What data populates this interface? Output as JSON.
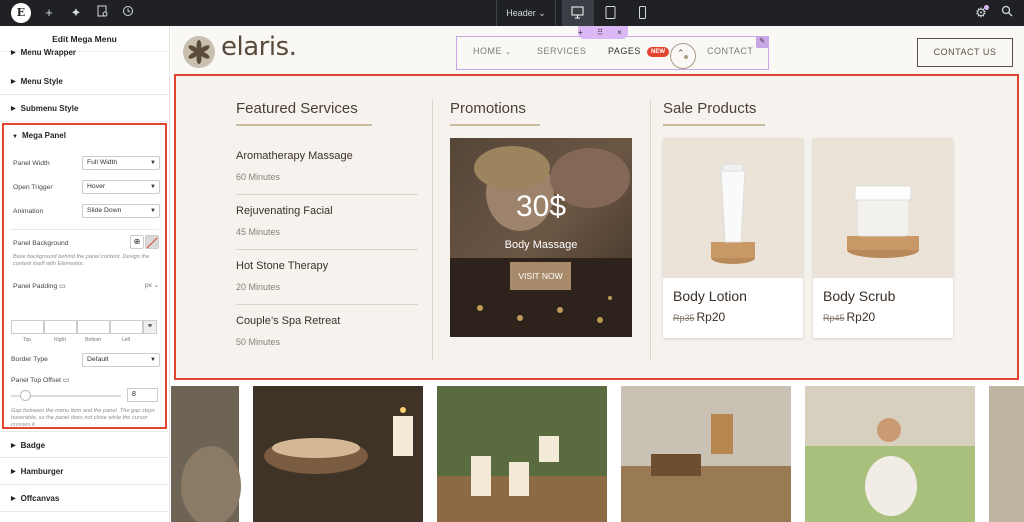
{
  "topbar": {
    "document": "Header",
    "icons": [
      "elementor-logo-icon",
      "plus-icon",
      "sparkle-icon",
      "page-settings-icon",
      "history-icon",
      "desktop-icon",
      "tablet-icon",
      "mobile-icon",
      "wand-icon",
      "search-icon"
    ]
  },
  "panel": {
    "title": "Edit Mega Menu",
    "sections": [
      "Menu Wrapper",
      "Menu Style",
      "Submenu Style"
    ],
    "mega": {
      "title": "Mega Panel",
      "panel_width_label": "Panel Width",
      "panel_width_value": "Full Width",
      "open_trigger_label": "Open Trigger",
      "open_trigger_value": "Hover",
      "animation_label": "Animation",
      "animation_value": "Slide Down",
      "panel_bg_label": "Panel Background",
      "panel_bg_hint": "Base background behind the panel content. Design the content itself with Elementor.",
      "panel_padding_label": "Panel Padding",
      "unit": "px",
      "pad_labels": [
        "Top",
        "Right",
        "Bottom",
        "Left"
      ],
      "border_type_label": "Border Type",
      "border_type_value": "Default",
      "top_offset_label": "Panel Top Offset",
      "top_offset_value": "8",
      "top_offset_hint": "Gap between the menu item and the panel. The gap stays hoverable, so the panel does not close while the cursor crosses it."
    },
    "lower_sections": [
      "Badge",
      "Hamburger",
      "Offcanvas"
    ]
  },
  "site": {
    "brand": "elaris.",
    "nav": [
      "HOME",
      "SERVICES",
      "PAGES",
      "CONTACT"
    ],
    "badge": "NEW",
    "contact_button": "CONTACT US"
  },
  "mega_panel": {
    "featured_title": "Featured Services",
    "services": [
      {
        "name": "Aromatherapy Massage",
        "time": "60 Minutes"
      },
      {
        "name": "Rejuvenating Facial",
        "time": "45 Minutes"
      },
      {
        "name": "Hot Stone Therapy",
        "time": "20 Minutes"
      },
      {
        "name": "Couple’s Spa Retreat",
        "time": "50 Minutes"
      }
    ],
    "promotions_title": "Promotions",
    "promo_price": "30$",
    "promo_name": "Body Massage",
    "promo_button": "VISIT NOW",
    "sale_title": "Sale Products",
    "products": [
      {
        "name": "Body Lotion",
        "old": "Rp35",
        "price": "Rp20"
      },
      {
        "name": "Body Scrub",
        "old": "Rp45",
        "price": "Rp20"
      }
    ]
  },
  "colors": {
    "accent": "#e1452f",
    "brand": "#5a4b3a",
    "selection": "#c9a7e6"
  }
}
